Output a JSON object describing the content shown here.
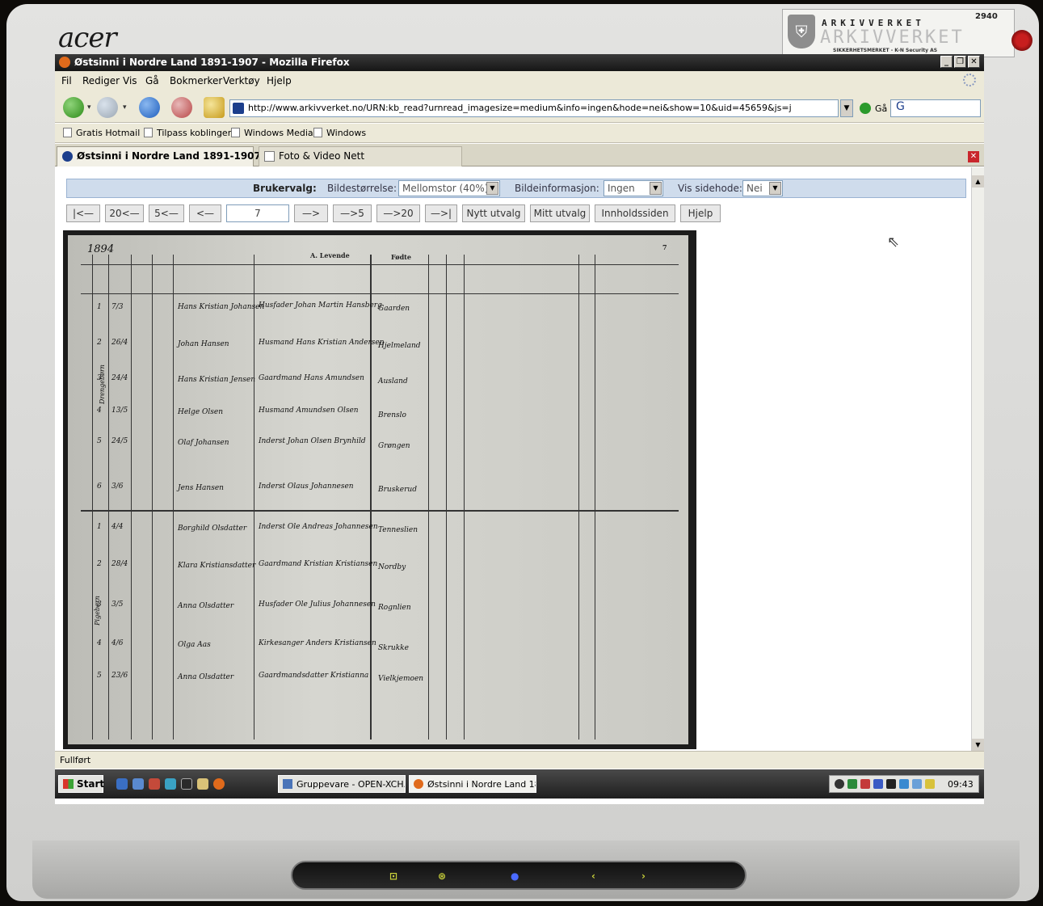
{
  "monitor": {
    "brand": "acer",
    "sticker": {
      "line1": "ARKIVVERKET",
      "line2": "ARKIVVERKET",
      "number": "2940",
      "line3": "SIKKERHETSMERKET - K-N Security AS"
    }
  },
  "window": {
    "title": "Østsinni i Nordre Land 1891-1907 - Mozilla Firefox"
  },
  "menu": [
    "Fil",
    "Rediger",
    "Vis",
    "Gå",
    "Bokmerker",
    "Verktøy",
    "Hjelp"
  ],
  "nav": {
    "url": "http://www.arkivverket.no/URN:kb_read?urnread_imagesize=medium&info=ingen&hode=nei&show=10&uid=45659&js=j",
    "go_label": "Gå",
    "search_placeholder": "G"
  },
  "bookmarks": [
    "Gratis Hotmail",
    "Tilpass koblinger",
    "Windows Media",
    "Windows"
  ],
  "tabs": [
    {
      "label": "Østsinni i Nordre Land 1891-1907",
      "active": true
    },
    {
      "label": "Foto & Video Nett",
      "active": false
    }
  ],
  "options": {
    "heading": "Brukervalg:",
    "image_size_label": "Bildestørrelse:",
    "image_size_value": "Mellomstor (40%)",
    "image_info_label": "Bildeinformasjon:",
    "image_info_value": "Ingen",
    "show_header_label": "Vis sidehode:",
    "show_header_value": "Nei"
  },
  "pager": {
    "first": "|<—",
    "back20": "20<—",
    "back5": "5<—",
    "back1": "<—",
    "page": "7",
    "fwd1": "—>",
    "fwd5": "—>5",
    "fwd20": "—>20",
    "last": "—>|",
    "new_selection": "Nytt utvalg",
    "my_selection": "Mitt utvalg",
    "contents": "Innholdssiden",
    "help": "Hjelp"
  },
  "ledger": {
    "year": "1894",
    "section": "A. Levende",
    "col_birth": "Fødte",
    "page_no": "7",
    "rows": [
      {
        "no": "1",
        "date": "7/3",
        "name": "Hans Kristian Johansen",
        "parents": "Husfader Johan Martin Hansberg",
        "place": "Gaarden"
      },
      {
        "no": "2",
        "date": "26/4",
        "name": "Johan Hansen",
        "parents": "Husmand Hans Kristian Andersen",
        "place": "Hjelmeland"
      },
      {
        "no": "3",
        "date": "24/4",
        "name": "Hans Kristian Jensen",
        "parents": "Gaardmand Hans Amundsen",
        "place": "Ausland"
      },
      {
        "no": "4",
        "date": "13/5",
        "name": "Helge Olsen",
        "parents": "Husmand Amundsen Olsen",
        "place": "Brenslo"
      },
      {
        "no": "5",
        "date": "24/5",
        "name": "Olaf Johansen",
        "parents": "Inderst Johan Olsen Brynhild",
        "place": "Grøngen"
      },
      {
        "no": "6",
        "date": "3/6",
        "name": "Jens Hansen",
        "parents": "Inderst Olaus Johannesen",
        "place": "Bruskerud"
      },
      {
        "no": "1",
        "date": "4/4",
        "name": "Borghild Olsdatter",
        "parents": "Inderst Ole Andreas Johannesen",
        "place": "Tenneslien"
      },
      {
        "no": "2",
        "date": "28/4",
        "name": "Klara Kristiansdatter",
        "parents": "Gaardmand Kristian Kristiansen",
        "place": "Nordby"
      },
      {
        "no": "3",
        "date": "3/5",
        "name": "Anna Olsdatter",
        "parents": "Husfader Ole Julius Johannesen",
        "place": "Rognlien"
      },
      {
        "no": "4",
        "date": "4/6",
        "name": "Olga Aas",
        "parents": "Kirkesanger Anders Kristiansen",
        "place": "Skrukke"
      },
      {
        "no": "5",
        "date": "23/6",
        "name": "Anna Olsdatter",
        "parents": "Gaardmandsdatter Kristianna",
        "place": "Vielkjemoen"
      }
    ],
    "group_boys": "Drengebørn",
    "group_girls": "Pigebørn"
  },
  "status": {
    "text": "Fullført"
  },
  "taskbar": {
    "start": "Start",
    "tasks": [
      "Gruppevare - OPEN-XCH...",
      "Østsinni i Nordre Land 18..."
    ],
    "clock": "09:43"
  }
}
